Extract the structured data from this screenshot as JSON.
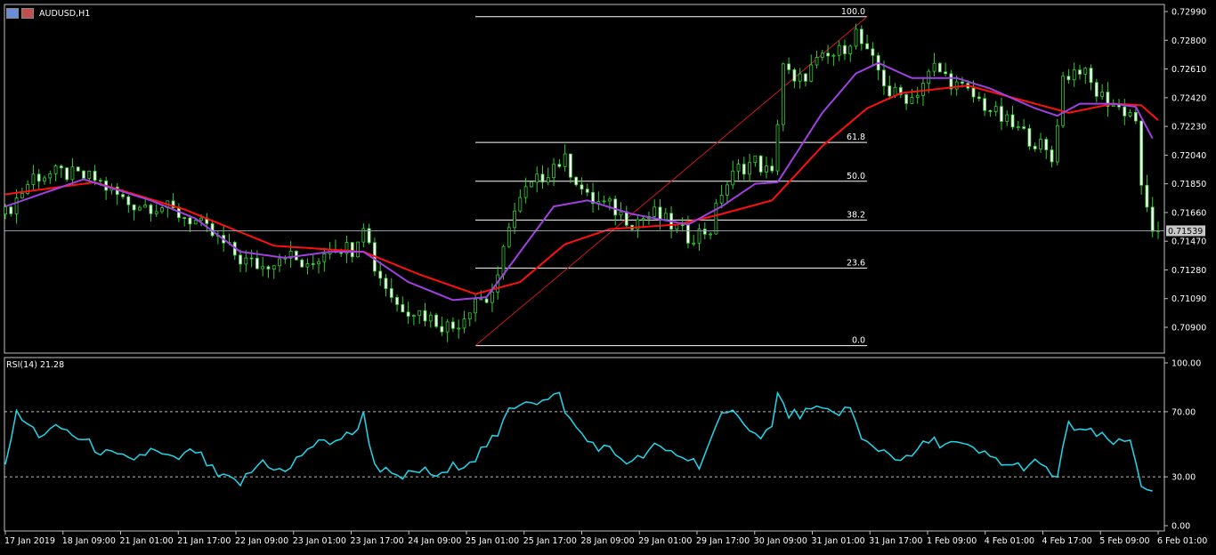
{
  "window": {
    "symbol_label": "AUDUSD,H1",
    "indicator_label": "RSI(14) 21.28",
    "current_price_label": "0.71539"
  },
  "colors": {
    "background": "#000000",
    "frame": "#c0c0c0",
    "bull_candle": "#32cd32",
    "bear_candle": "#ffffff",
    "ma_fast": "#a040e0",
    "ma_slow": "#ff1010",
    "rsi_line": "#1fd8ee",
    "fib_line": "#ffffff",
    "trend_line": "#cc1a1a"
  },
  "icons": [
    "chart-window-icon",
    "chart-window-icon-2"
  ],
  "chart_data": [
    {
      "type": "candlestick",
      "title": "AUDUSD,H1",
      "ylim": [
        0.708,
        0.7299
      ],
      "y_ticks": [
        "0.72990",
        "0.72800",
        "0.72610",
        "0.72420",
        "0.72230",
        "0.72040",
        "0.71850",
        "0.71660",
        "0.71470",
        "0.71280",
        "0.71090",
        "0.70900"
      ],
      "current_price": 0.71539,
      "x_ticks": [
        "17 Jan 2019",
        "18 Jan 09:00",
        "21 Jan 01:00",
        "21 Jan 17:00",
        "22 Jan 09:00",
        "23 Jan 01:00",
        "23 Jan 17:00",
        "24 Jan 09:00",
        "25 Jan 01:00",
        "25 Jan 17:00",
        "28 Jan 09:00",
        "29 Jan 01:00",
        "29 Jan 17:00",
        "30 Jan 09:00",
        "31 Jan 01:00",
        "31 Jan 17:00",
        "1 Feb 09:00",
        "4 Feb 01:00",
        "4 Feb 17:00",
        "5 Feb 09:00",
        "6 Feb 01:00"
      ],
      "close_path": [
        [
          0,
          0.7165
        ],
        [
          5,
          0.719
        ],
        [
          10,
          0.7192
        ],
        [
          16,
          0.7188
        ],
        [
          22,
          0.7172
        ],
        [
          28,
          0.717
        ],
        [
          34,
          0.716
        ],
        [
          38,
          0.7148
        ],
        [
          42,
          0.7135
        ],
        [
          46,
          0.713
        ],
        [
          50,
          0.714
        ],
        [
          54,
          0.7128
        ],
        [
          58,
          0.7145
        ],
        [
          62,
          0.7142
        ],
        [
          64,
          0.716
        ],
        [
          66,
          0.713
        ],
        [
          70,
          0.7105
        ],
        [
          74,
          0.71
        ],
        [
          78,
          0.7092
        ],
        [
          80,
          0.709
        ],
        [
          82,
          0.7098
        ],
        [
          84,
          0.711
        ],
        [
          86,
          0.7108
        ],
        [
          88,
          0.712
        ],
        [
          90,
          0.716
        ],
        [
          93,
          0.718
        ],
        [
          96,
          0.719
        ],
        [
          98,
          0.7198
        ],
        [
          100,
          0.72
        ],
        [
          102,
          0.7188
        ],
        [
          104,
          0.7175
        ],
        [
          108,
          0.717
        ],
        [
          112,
          0.716
        ],
        [
          116,
          0.7165
        ],
        [
          118,
          0.716
        ],
        [
          122,
          0.715
        ],
        [
          126,
          0.7155
        ],
        [
          128,
          0.718
        ],
        [
          131,
          0.7195
        ],
        [
          134,
          0.72
        ],
        [
          137,
          0.719
        ],
        [
          139,
          0.7265
        ],
        [
          141,
          0.725
        ],
        [
          145,
          0.7265
        ],
        [
          149,
          0.7272
        ],
        [
          152,
          0.7285
        ],
        [
          154,
          0.727
        ],
        [
          156,
          0.726
        ],
        [
          158,
          0.7245
        ],
        [
          162,
          0.7242
        ],
        [
          166,
          0.7262
        ],
        [
          170,
          0.725
        ],
        [
          174,
          0.724
        ],
        [
          178,
          0.7228
        ],
        [
          182,
          0.7218
        ],
        [
          185,
          0.721
        ],
        [
          187,
          0.72
        ],
        [
          189,
          0.7255
        ],
        [
          192,
          0.7262
        ],
        [
          195,
          0.7245
        ],
        [
          199,
          0.7235
        ],
        [
          201,
          0.7232
        ],
        [
          202,
          0.7228
        ],
        [
          203,
          0.718
        ],
        [
          205,
          0.7156
        ],
        [
          206,
          0.71539
        ]
      ],
      "ma_fast": [
        [
          0,
          0.717
        ],
        [
          14,
          0.7188
        ],
        [
          26,
          0.7174
        ],
        [
          34,
          0.7162
        ],
        [
          42,
          0.714
        ],
        [
          50,
          0.7136
        ],
        [
          58,
          0.714
        ],
        [
          64,
          0.714
        ],
        [
          72,
          0.712
        ],
        [
          80,
          0.7108
        ],
        [
          86,
          0.711
        ],
        [
          92,
          0.714
        ],
        [
          98,
          0.717
        ],
        [
          104,
          0.7174
        ],
        [
          112,
          0.7165
        ],
        [
          122,
          0.7158
        ],
        [
          128,
          0.717
        ],
        [
          134,
          0.7185
        ],
        [
          138,
          0.7186
        ],
        [
          146,
          0.7232
        ],
        [
          152,
          0.7258
        ],
        [
          156,
          0.7265
        ],
        [
          162,
          0.7255
        ],
        [
          170,
          0.7255
        ],
        [
          176,
          0.7248
        ],
        [
          184,
          0.7235
        ],
        [
          188,
          0.723
        ],
        [
          192,
          0.7238
        ],
        [
          198,
          0.7238
        ],
        [
          202,
          0.7236
        ],
        [
          205,
          0.7215
        ]
      ],
      "ma_slow": [
        [
          0,
          0.7178
        ],
        [
          16,
          0.7186
        ],
        [
          32,
          0.7168
        ],
        [
          48,
          0.7144
        ],
        [
          64,
          0.714
        ],
        [
          74,
          0.7125
        ],
        [
          84,
          0.7112
        ],
        [
          92,
          0.712
        ],
        [
          100,
          0.7145
        ],
        [
          108,
          0.7155
        ],
        [
          120,
          0.7158
        ],
        [
          128,
          0.7165
        ],
        [
          137,
          0.7174
        ],
        [
          146,
          0.721
        ],
        [
          154,
          0.7235
        ],
        [
          160,
          0.7245
        ],
        [
          172,
          0.725
        ],
        [
          184,
          0.7238
        ],
        [
          190,
          0.7232
        ],
        [
          198,
          0.7238
        ],
        [
          203,
          0.7237
        ],
        [
          206,
          0.7227
        ]
      ],
      "fibonacci": {
        "time_range": [
          84,
          154
        ],
        "levels": [
          {
            "label": "100.0",
            "price": 0.72956
          },
          {
            "label": "61.8",
            "price": 0.72124
          },
          {
            "label": "50.0",
            "price": 0.71867
          },
          {
            "label": "38.2",
            "price": 0.7161
          },
          {
            "label": "23.6",
            "price": 0.71292
          },
          {
            "label": "0.0",
            "price": 0.70779
          }
        ]
      }
    },
    {
      "type": "line",
      "title": "RSI(14) 21.28",
      "ylim": [
        0,
        100
      ],
      "y_ticks": [
        "100.00",
        "70.00",
        "30.00",
        "0.00"
      ],
      "levels": [
        70,
        30
      ],
      "current_value": 21.28,
      "series": [
        {
          "values": [
            [
              0,
              40
            ],
            [
              2,
              68
            ],
            [
              6,
              56
            ],
            [
              10,
              60
            ],
            [
              14,
              52
            ],
            [
              18,
              44
            ],
            [
              22,
              40
            ],
            [
              26,
              46
            ],
            [
              30,
              40
            ],
            [
              34,
              46
            ],
            [
              38,
              30
            ],
            [
              42,
              26
            ],
            [
              46,
              40
            ],
            [
              50,
              32
            ],
            [
              54,
              48
            ],
            [
              58,
              52
            ],
            [
              62,
              56
            ],
            [
              64,
              68
            ],
            [
              66,
              38
            ],
            [
              70,
              28
            ],
            [
              74,
              34
            ],
            [
              78,
              30
            ],
            [
              80,
              36
            ],
            [
              84,
              42
            ],
            [
              86,
              50
            ],
            [
              88,
              54
            ],
            [
              90,
              72
            ],
            [
              93,
              78
            ],
            [
              96,
              76
            ],
            [
              99,
              80
            ],
            [
              101,
              64
            ],
            [
              104,
              52
            ],
            [
              108,
              46
            ],
            [
              112,
              38
            ],
            [
              116,
              48
            ],
            [
              120,
              44
            ],
            [
              124,
              38
            ],
            [
              128,
              66
            ],
            [
              131,
              70
            ],
            [
              134,
              55
            ],
            [
              137,
              60
            ],
            [
              138,
              80
            ],
            [
              140,
              68
            ],
            [
              144,
              70
            ],
            [
              148,
              70
            ],
            [
              151,
              72
            ],
            [
              153,
              52
            ],
            [
              157,
              46
            ],
            [
              161,
              40
            ],
            [
              165,
              52
            ],
            [
              170,
              50
            ],
            [
              176,
              42
            ],
            [
              180,
              36
            ],
            [
              184,
              38
            ],
            [
              188,
              30
            ],
            [
              190,
              62
            ],
            [
              193,
              58
            ],
            [
              196,
              54
            ],
            [
              199,
              50
            ],
            [
              201,
              52
            ],
            [
              203,
              26
            ],
            [
              205,
              21.28
            ]
          ]
        }
      ]
    }
  ]
}
